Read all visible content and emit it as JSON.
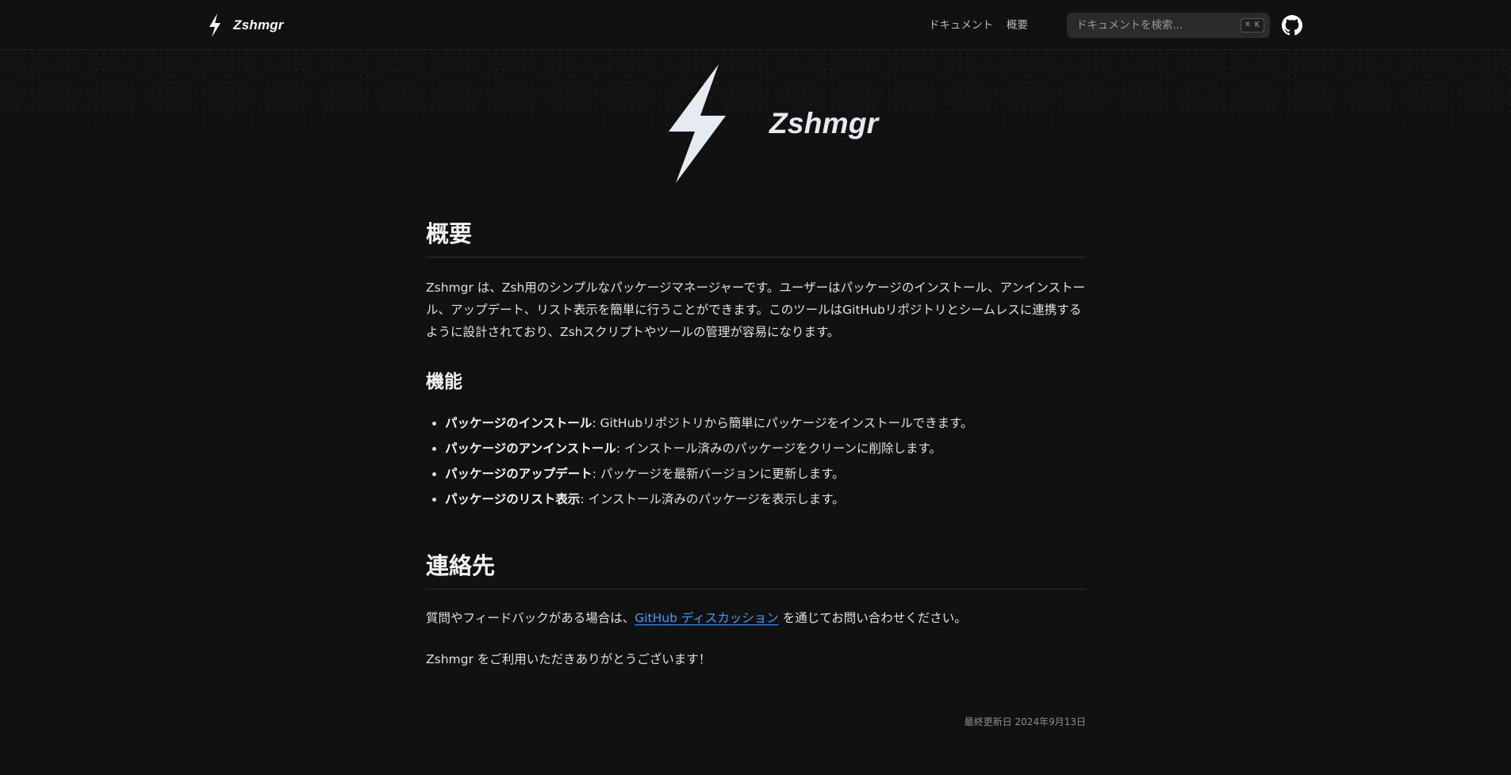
{
  "navbar": {
    "brand": "Zshmgr",
    "links": [
      "ドキュメント",
      "概要"
    ],
    "search_placeholder": "ドキュメントを検索...",
    "search_shortcut": "⌘ K",
    "github_icon": "github-icon"
  },
  "hero": {
    "title": "Zshmgr",
    "icon": "lightning-bolt-icon"
  },
  "overview": {
    "heading": "概要",
    "body": "Zshmgr は、Zsh用のシンプルなパッケージマネージャーです。ユーザーはパッケージのインストール、アンインストール、アップデート、リスト表示を簡単に行うことができます。このツールはGitHubリポジトリとシームレスに連携するように設計されており、Zshスクリプトやツールの管理が容易になります。"
  },
  "features": {
    "heading": "機能",
    "items": [
      {
        "title": "パッケージのインストール",
        "text": ": GitHubリポジトリから簡単にパッケージをインストールできます。"
      },
      {
        "title": "パッケージのアンインストール",
        "text": ": インストール済みのパッケージをクリーンに削除します。"
      },
      {
        "title": "パッケージのアップデート",
        "text": ": パッケージを最新バージョンに更新します。"
      },
      {
        "title": "パッケージのリスト表示",
        "text": ": インストール済みのパッケージを表示します。"
      }
    ]
  },
  "contact": {
    "heading": "連絡先",
    "prefix": "質問やフィードバックがある場合は、",
    "link_text": "GitHub ディスカッション",
    "suffix": " を通じてお問い合わせください。",
    "thanks": "Zshmgr をご利用いただきありがとうございます！"
  },
  "footer": {
    "last_updated": "最終更新日 2024年9月13日"
  },
  "colors": {
    "background": "#111111",
    "link": "#3b9eff",
    "bolt": "#e6ebf2"
  }
}
